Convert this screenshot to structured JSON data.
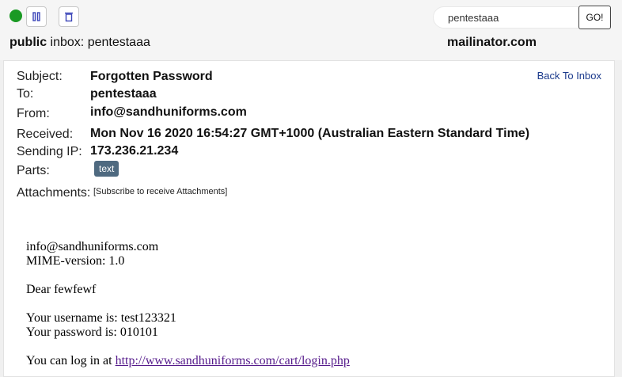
{
  "topbar": {
    "inbox_prefix": "public",
    "inbox_label": " inbox: pentestaaa",
    "search_value": "pentestaaa",
    "go_label": "GO!",
    "site_name": "mailinator.com"
  },
  "message": {
    "back_link": "Back To Inbox",
    "headers": {
      "subject_label": "Subject:",
      "subject": "Forgotten Password",
      "to_label": "To:",
      "to": "pentestaaa",
      "from_label": "From:",
      "from": "info@sandhuniforms.com",
      "received_label": "Received:",
      "received": "Mon Nov 16 2020 16:54:27 GMT+1000 (Australian Eastern Standard Time)",
      "ip_label": "Sending IP:",
      "ip": "173.236.21.234",
      "parts_label": "Parts:",
      "parts_badge": "text",
      "attachments_label": "Attachments:",
      "attachments_note": "[Subscribe to receive Attachments]"
    },
    "body": {
      "line1": "info@sandhuniforms.com",
      "line2": "MIME-version: 1.0",
      "greeting": "Dear fewfewf",
      "username_line": "Your username is: test123321",
      "password_line": "Your password is: 010101",
      "login_prefix": "You can log in at ",
      "login_url": "http://www.sandhuniforms.com/cart/login.php"
    }
  },
  "colors": {
    "status_dot": "#1a9a24",
    "parts_badge_bg": "#4f6a80",
    "back_link": "#1b3a8c",
    "visited_link": "#551a8b"
  },
  "icons": {
    "status": "status-dot",
    "pause": "pause-icon",
    "trash": "trash-icon"
  }
}
